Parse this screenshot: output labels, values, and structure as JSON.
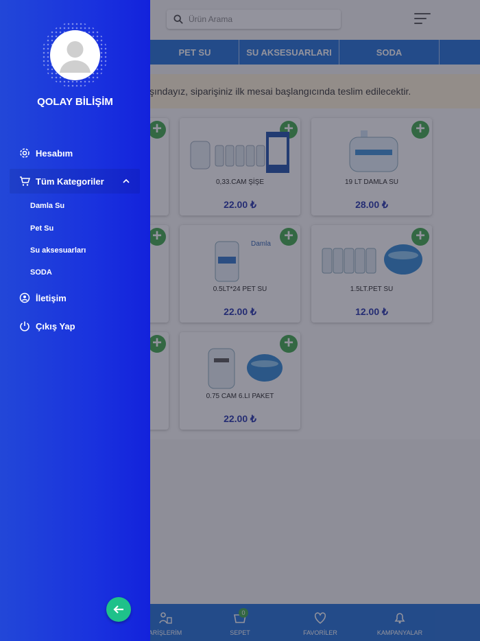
{
  "header": {
    "search_placeholder": "Ürün Arama"
  },
  "tabs": [
    "PET SU",
    "SU AKSESUARLARI",
    "SODA"
  ],
  "notice": "şındayız, siparişiniz ilk mesai başlangıcında teslim edilecektir.",
  "products": [
    {
      "name": "0,33.CAM ŞİŞE",
      "price": "22.00 ₺"
    },
    {
      "name": "19 LT DAMLA SU",
      "price": "28.00 ₺"
    },
    {
      "name": "0.5LT*24 PET SU",
      "price": "22.00 ₺"
    },
    {
      "name": "1.5LT.PET SU",
      "price": "12.00 ₺"
    },
    {
      "name": "0.75 CAM 6.LI PAKET",
      "price": "22.00 ₺"
    }
  ],
  "bottom_nav": {
    "orders": "ARİŞLERİM",
    "cart": "SEPET",
    "cart_count": "0",
    "favorites": "FAVORİLER",
    "campaigns": "KAMPANYALAR"
  },
  "drawer": {
    "user_name": "QOLAY BİLİŞİM",
    "menu": {
      "account": "Hesabım",
      "categories": "Tüm Kategoriler",
      "contact": "İletişim",
      "logout": "Çıkış Yap"
    },
    "subcategories": [
      "Damla Su",
      "Pet Su",
      "Su aksesuarları",
      "SODA"
    ]
  },
  "colors": {
    "drawer_start": "#2247d8",
    "drawer_end": "#1322dc",
    "brand_blue": "#1f6fd6",
    "add_green": "#3fa84b",
    "back_button": "#1fc18a",
    "price": "#2233aa"
  }
}
